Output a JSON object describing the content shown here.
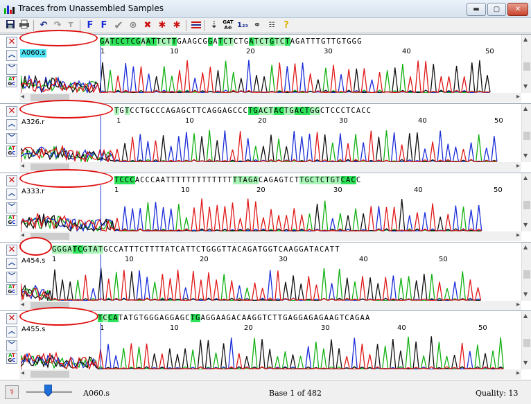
{
  "window": {
    "title": "Traces from Unassembled Samples",
    "minimize": "▬",
    "maximize": "▢",
    "close": "✕"
  },
  "toolbar": {
    "icons": [
      "save-icon",
      "print-icon",
      "undo-icon",
      "redo-icon",
      "text-cursor-icon",
      "previous-flag-icon",
      "next-flag-icon",
      "accept-icon",
      "reject-icon",
      "clear-icon",
      "edit-previous-icon",
      "edit-next-icon",
      "sort-icon",
      "anchor-icon",
      "gat-icon",
      "numbers-icon",
      "link-icon",
      "properties-icon",
      "help-icon"
    ],
    "gat_label": "GAT"
  },
  "panels": [
    {
      "name": "A060.s",
      "selected": true,
      "sequence": "GATCCTCGAATTCTTGAAGCGGATCTCTGATCTGTCTAGATTTGTTGTGGG",
      "ruler": [
        "1",
        "10",
        "20",
        "30",
        "40",
        "50"
      ]
    },
    {
      "name": "A326.r",
      "selected": false,
      "sequence": "TGTCCTGCCCAGAGCTTCAGGAGCCCTGACTACTGACTGGCTCCCTCACC",
      "ruler": [
        "1",
        "10",
        "20",
        "30",
        "40",
        "50"
      ]
    },
    {
      "name": "A333.r",
      "selected": false,
      "sequence": "TCCCACCCAATTTTTTTTTTTTTTTAGACAGAGTCTTGCTCTGTCACC",
      "ruler": [
        "1",
        "10",
        "20",
        "30",
        "40",
        "50"
      ]
    },
    {
      "name": "A454.s",
      "selected": false,
      "sequence": "GGGATCGTATGCCATTTCTTTTATCATTCTGGGTTACAGATGGTCAAGGATACATT",
      "ruler": [
        "1",
        "10",
        "20",
        "30",
        "40",
        "50"
      ]
    },
    {
      "name": "A455.s",
      "selected": false,
      "sequence": "TCCATATGTGGGAGGAGCTGAGGAAGACAAGGTCTTGAGGAGAGAAGTCAGAA",
      "ruler": [
        "1",
        "10",
        "20",
        "30",
        "40",
        "50"
      ]
    }
  ],
  "status": {
    "sample": "A060.s",
    "base": "Base 1 of 482",
    "quality": "Quality: 13"
  },
  "colors": {
    "A": "#10b010",
    "C": "#1a2cd8",
    "G": "#111111",
    "T": "#e01818",
    "highlight": "#2ee25a",
    "selected_name": "#4fe3f3"
  }
}
